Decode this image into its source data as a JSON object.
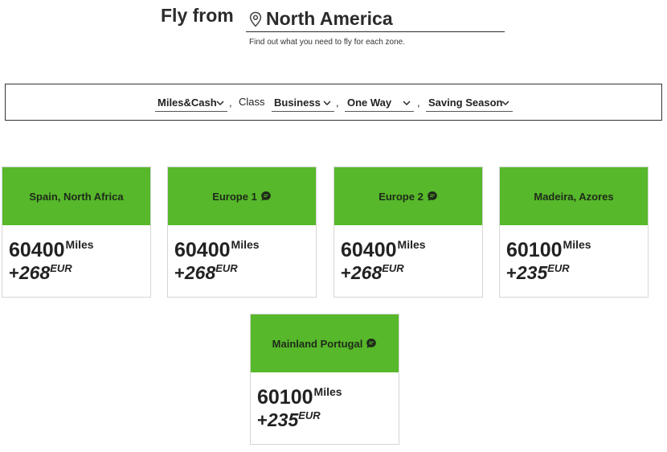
{
  "header": {
    "fly_from_label": "Fly from",
    "origin": "North America",
    "subtitle": "Find out what you need to fly for each zone.",
    "origin_icon": "location-pin-icon"
  },
  "filters": {
    "payment": {
      "value": "Miles&Cash"
    },
    "class_label": "Class",
    "class": {
      "value": "Business"
    },
    "trip": {
      "value": "One Way"
    },
    "season": {
      "value": "Saving Season"
    },
    "separator": ","
  },
  "colors": {
    "header_green": "#56b82a",
    "text_dark": "#222222"
  },
  "zones": [
    {
      "name": "Spain, North Africa",
      "has_info_icon": false,
      "miles": "60400",
      "miles_unit": "Miles",
      "plus": "+",
      "cash": "268",
      "currency": "EUR"
    },
    {
      "name": "Europe 1",
      "has_info_icon": true,
      "miles": "60400",
      "miles_unit": "Miles",
      "plus": "+",
      "cash": "268",
      "currency": "EUR"
    },
    {
      "name": "Europe 2",
      "has_info_icon": true,
      "miles": "60400",
      "miles_unit": "Miles",
      "plus": "+",
      "cash": "268",
      "currency": "EUR"
    },
    {
      "name": "Madeira, Azores",
      "has_info_icon": false,
      "miles": "60100",
      "miles_unit": "Miles",
      "plus": "+",
      "cash": "235",
      "currency": "EUR"
    },
    {
      "name": "Mainland Portugal",
      "has_info_icon": true,
      "miles": "60100",
      "miles_unit": "Miles",
      "plus": "+",
      "cash": "235",
      "currency": "EUR"
    }
  ]
}
